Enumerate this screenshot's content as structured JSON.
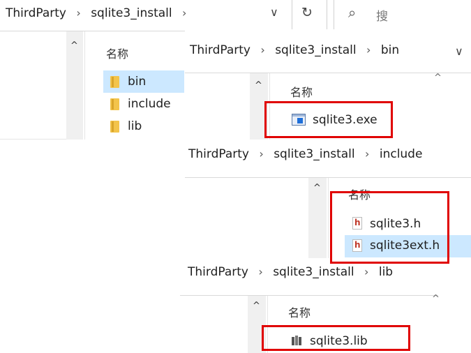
{
  "window1": {
    "breadcrumb": [
      "ThirdParty",
      "sqlite3_install"
    ],
    "column_header": "名称",
    "search_placeholder": "搜",
    "items": [
      "bin",
      "include",
      "lib"
    ]
  },
  "window_bin": {
    "breadcrumb": [
      "ThirdParty",
      "sqlite3_install",
      "bin"
    ],
    "column_header": "名称",
    "files": [
      "sqlite3.exe"
    ]
  },
  "window_include": {
    "breadcrumb": [
      "ThirdParty",
      "sqlite3_install",
      "include"
    ],
    "column_header": "名称",
    "files": [
      "sqlite3.h",
      "sqlite3ext.h"
    ]
  },
  "window_lib": {
    "breadcrumb": [
      "ThirdParty",
      "sqlite3_install",
      "lib"
    ],
    "column_header": "名称",
    "files": [
      "sqlite3.lib"
    ]
  },
  "glyphs": {
    "chevron": "›",
    "dropdown": "∨",
    "refresh": "↻",
    "search": "⌕",
    "scroll_up": "^"
  },
  "colors": {
    "selection": "#cce8ff",
    "highlight_box": "#e00000",
    "folder": "#f3c44b"
  }
}
